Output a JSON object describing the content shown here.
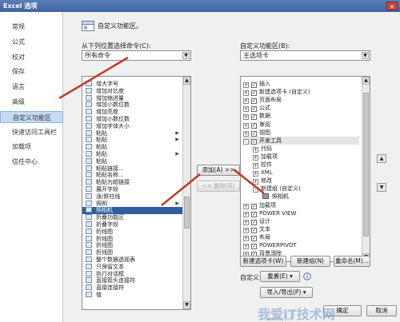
{
  "window": {
    "title": "Excel 选项",
    "close": "×"
  },
  "sidebar": {
    "items": [
      "常规",
      "公式",
      "校对",
      "保存",
      "语言",
      "高级",
      "自定义功能区",
      "快速访问工具栏",
      "加载项",
      "信任中心"
    ],
    "selected_index": 6
  },
  "header": {
    "title": "自定义功能区。"
  },
  "left": {
    "choose_label": "从下列位置选择命令(C):",
    "choose_value": "所有命令",
    "commands": [
      "增大字号",
      "增加对比度",
      "增加缩进量",
      "增加小数位数",
      "增加亮度",
      "增加小数位数",
      "增加字体大小",
      "粘贴",
      "粘贴",
      "粘贴",
      "粘贴",
      "粘贴",
      "粘贴链接...",
      "粘贴名称...",
      "粘贴为超链接",
      "展开字段",
      "涨/跌柱线",
      "照明",
      "照相机",
      "折叠功能区",
      "折叠字段",
      "折线图",
      "折线图",
      "折线图",
      "折线图",
      "整个数据透视表",
      "只保留文本",
      "执行对话框",
      "直接箭头连接符",
      "直接连接符",
      "值"
    ],
    "submenu_rows": [
      7,
      8,
      10,
      17
    ],
    "selected_index": 18
  },
  "middle": {
    "add": "添加(A) >>",
    "remove": "<< 删除(R)"
  },
  "right": {
    "customize_label": "自定义功能区(B):",
    "customize_value": "主选项卡",
    "tree": [
      {
        "label": "插入",
        "level": 0,
        "exp": "+",
        "chk": true
      },
      {
        "label": "新建选项卡 (自定义)",
        "level": 0,
        "exp": "+",
        "chk": true
      },
      {
        "label": "页面布局",
        "level": 0,
        "exp": "+",
        "chk": true
      },
      {
        "label": "公式",
        "level": 0,
        "exp": "+",
        "chk": true
      },
      {
        "label": "数据",
        "level": 0,
        "exp": "+",
        "chk": true
      },
      {
        "label": "审阅",
        "level": 0,
        "exp": "+",
        "chk": true
      },
      {
        "label": "视图",
        "level": 0,
        "exp": "+",
        "chk": true
      },
      {
        "label": "开发工具",
        "level": 0,
        "exp": "-",
        "chk": true
      },
      {
        "label": "代码",
        "level": 1,
        "exp": "+",
        "chk": false
      },
      {
        "label": "加载项",
        "level": 1,
        "exp": "+",
        "chk": false
      },
      {
        "label": "控件",
        "level": 1,
        "exp": "+",
        "chk": false
      },
      {
        "label": "XML",
        "level": 1,
        "exp": "+",
        "chk": false
      },
      {
        "label": "修改",
        "level": 1,
        "exp": "+",
        "chk": false
      },
      {
        "label": "新建组 (自定义)",
        "level": 1,
        "exp": "-",
        "chk": false
      },
      {
        "label": "照相机",
        "level": 2,
        "exp": "",
        "chk": false
      },
      {
        "label": "加载项",
        "level": 0,
        "exp": "+",
        "chk": true
      },
      {
        "label": "POWER VIEW",
        "level": 0,
        "exp": "+",
        "chk": true
      },
      {
        "label": "设计",
        "level": 0,
        "exp": "+",
        "chk": true
      },
      {
        "label": "文本",
        "level": 0,
        "exp": "+",
        "chk": true
      },
      {
        "label": "布局",
        "level": 0,
        "exp": "+",
        "chk": true
      },
      {
        "label": "POWERPIVOT",
        "level": 0,
        "exp": "+",
        "chk": true
      },
      {
        "label": "背景消除",
        "level": 0,
        "exp": "+",
        "chk": true
      }
    ],
    "new_tab": "新建选项卡(W)",
    "new_group": "新建组(N)",
    "rename": "重命名(M)...",
    "custom_label": "自定义:",
    "reset": "重置(E) ▾",
    "import_export": "导入/导出(P) ▾"
  },
  "footer": {
    "ok": "确定",
    "cancel": "取消"
  },
  "watermark": {
    "text": "我爱IT技术网",
    "url": "www.52ij.com"
  },
  "colors": {
    "title_bar": "#4a70ae",
    "selection": "#2f5e9e",
    "sidebar_selected": "#c6dbf2",
    "arrow": "#c0392b"
  }
}
